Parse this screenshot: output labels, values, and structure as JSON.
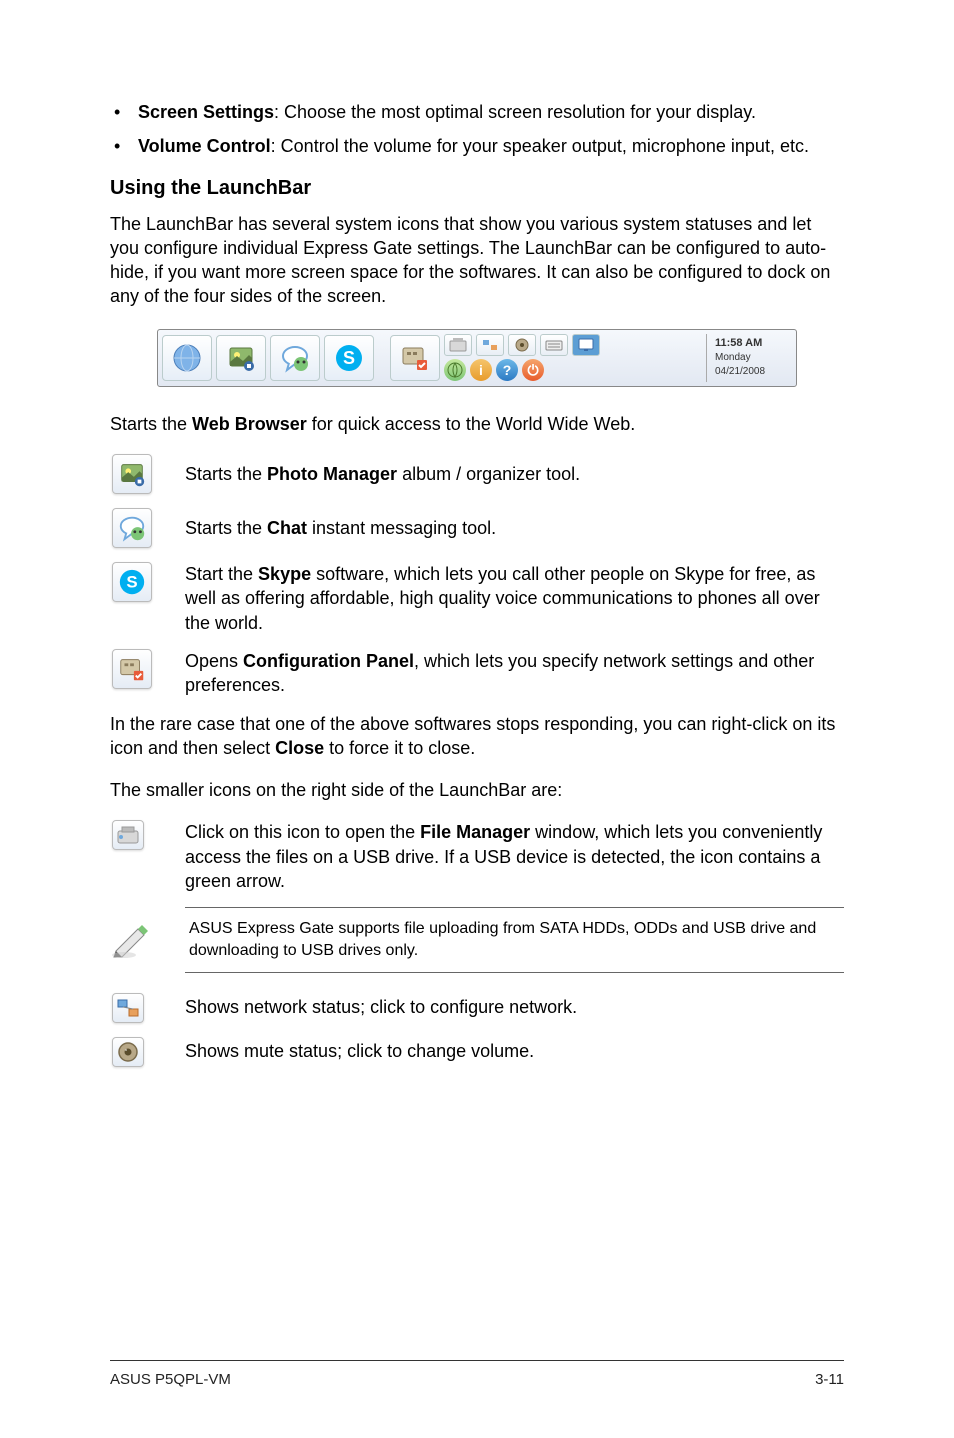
{
  "bullets": [
    {
      "label": "Screen Settings",
      "text": ": Choose the most optimal screen resolution for your display."
    },
    {
      "label": "Volume Control",
      "text": ": Control the volume for your speaker output, microphone input, etc."
    }
  ],
  "heading": "Using the LaunchBar",
  "intro": "The LaunchBar has several system icons that show you various system statuses and let you configure individual Express Gate settings. The LaunchBar can be configured to auto-hide, if you want more screen space for the softwares. It can also be configured to dock on any of the four sides of the screen.",
  "launchbar_clock": {
    "time": "11:58 AM",
    "day": "Monday",
    "date": "04/21/2008"
  },
  "web_browser_line_pre": "Starts the ",
  "web_browser_bold": "Web Browser",
  "web_browser_line_post": " for quick access to the World Wide Web.",
  "rows": {
    "photo": {
      "pre": "Starts the ",
      "bold": "Photo Manager",
      "post": " album / organizer tool."
    },
    "chat": {
      "pre": "Starts the ",
      "bold": "Chat",
      "post": " instant messaging tool."
    },
    "skype": {
      "pre": "Start the ",
      "bold": "Skype",
      "post": " software, which lets you call other people on Skype for free, as well as offering affordable, high quality voice communications to phones all over the world."
    },
    "config": {
      "pre": "Opens ",
      "bold": "Configuration Panel",
      "post": ", which lets you specify network settings and other preferences."
    }
  },
  "mid_para1_pre": "In the rare case that one of the above softwares stops responding, you can right-click on its icon and then select ",
  "mid_para1_bold": "Close",
  "mid_para1_post": " to force it to close.",
  "mid_para2": "The smaller icons on the right side of the LaunchBar are:",
  "rows2": {
    "file": {
      "pre": "Click on this icon to open the ",
      "bold": "File Manager",
      "post": " window, which lets you conveniently access the files on a USB drive. If a USB device is detected, the icon contains a green arrow."
    },
    "network": "Shows network status; click to configure network.",
    "mute": "Shows mute status; click to change volume."
  },
  "note": "ASUS Express Gate supports file uploading from SATA HDDs, ODDs and USB drive and downloading to USB drives only.",
  "footer_left": "ASUS P5QPL-VM",
  "footer_right": "3-11"
}
